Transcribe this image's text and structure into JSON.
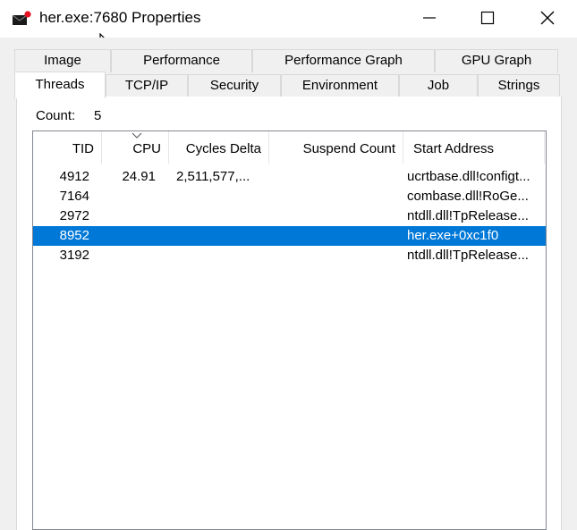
{
  "window": {
    "title": "her.exe:7680 Properties"
  },
  "tabs_back": [
    "Image",
    "Performance",
    "Performance Graph",
    "GPU Graph"
  ],
  "tabs_front": [
    "Threads",
    "TCP/IP",
    "Security",
    "Environment",
    "Job",
    "Strings"
  ],
  "active_tab": "Threads",
  "count": {
    "label": "Count:",
    "value": "5"
  },
  "columns": [
    "TID",
    "CPU",
    "Cycles Delta",
    "Suspend Count",
    "Start Address"
  ],
  "sort_column": "CPU",
  "rows": [
    {
      "tid": "4912",
      "cpu": "24.91",
      "cycles": "2,511,577,...",
      "suspend": "",
      "start": "ucrtbase.dll!configt..."
    },
    {
      "tid": "7164",
      "cpu": "",
      "cycles": "",
      "suspend": "",
      "start": "combase.dll!RoGe..."
    },
    {
      "tid": "2972",
      "cpu": "",
      "cycles": "",
      "suspend": "",
      "start": "ntdll.dll!TpRelease..."
    },
    {
      "tid": "8952",
      "cpu": "",
      "cycles": "",
      "suspend": "",
      "start": "her.exe+0xc1f0",
      "selected": true
    },
    {
      "tid": "3192",
      "cpu": "",
      "cycles": "",
      "suspend": "",
      "start": "ntdll.dll!TpRelease..."
    }
  ],
  "colors": {
    "selection": "#0078d7",
    "icon_red": "#e81123"
  },
  "icons": {
    "app": "envelope-icon",
    "minimize": "minimize-icon",
    "maximize": "maximize-icon",
    "close": "close-icon",
    "cursor": "mouse-cursor-icon",
    "sort": "sort-descending-icon"
  }
}
